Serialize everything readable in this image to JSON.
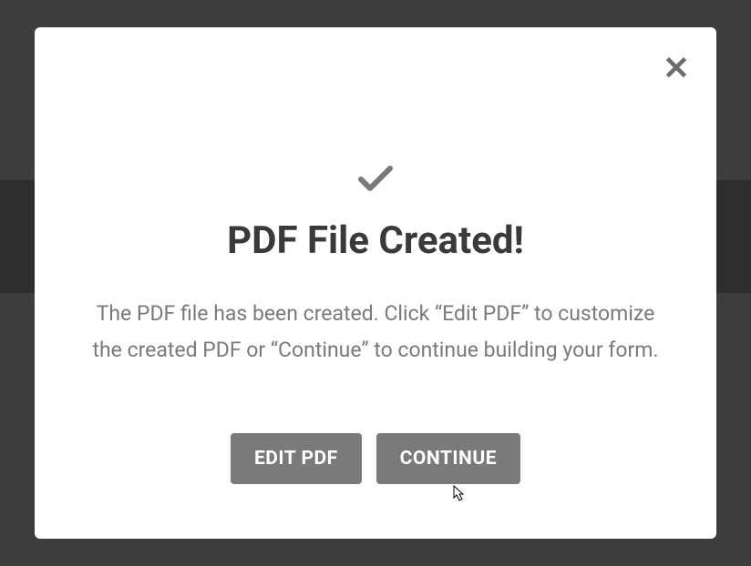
{
  "modal": {
    "title": "PDF File Created!",
    "description": "The PDF file has been created. Click “Edit PDF” to customize the created PDF or “Continue” to continue building your form.",
    "edit_label": "EDIT PDF",
    "continue_label": "CONTINUE"
  }
}
